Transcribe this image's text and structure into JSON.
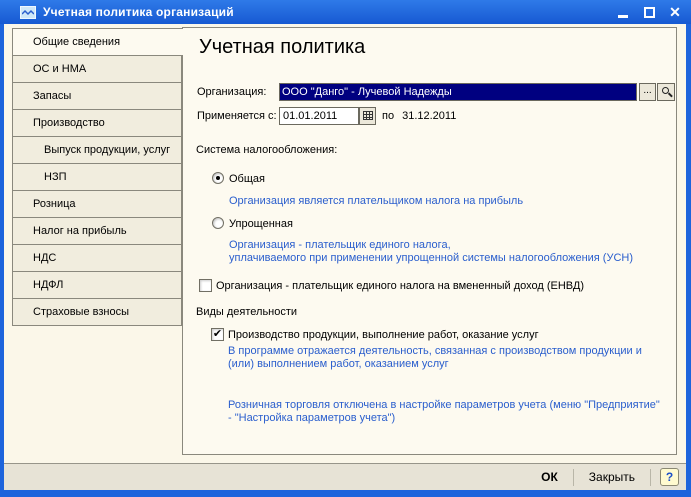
{
  "window": {
    "title": "Учетная политика организаций",
    "controls": {
      "minimize": "minimize",
      "maximize": "maximize",
      "close": "close"
    }
  },
  "sidebar": {
    "tabs": [
      {
        "label": "Общие сведения",
        "selected": true,
        "indent": false
      },
      {
        "label": "ОС и НМА",
        "selected": false,
        "indent": false
      },
      {
        "label": "Запасы",
        "selected": false,
        "indent": false
      },
      {
        "label": "Производство",
        "selected": false,
        "indent": false
      },
      {
        "label": "Выпуск продукции, услуг",
        "selected": false,
        "indent": true
      },
      {
        "label": "НЗП",
        "selected": false,
        "indent": true
      },
      {
        "label": "Розница",
        "selected": false,
        "indent": false
      },
      {
        "label": "Налог на прибыль",
        "selected": false,
        "indent": false
      },
      {
        "label": "НДС",
        "selected": false,
        "indent": false
      },
      {
        "label": "НДФЛ",
        "selected": false,
        "indent": false
      },
      {
        "label": "Страховые взносы",
        "selected": false,
        "indent": false
      }
    ]
  },
  "main": {
    "heading": "Учетная политика",
    "organization": {
      "label": "Организация:",
      "value": "ООО \"Данго\" - Лучевой Надежды",
      "ellipsis_button": "...",
      "magnifier_button": "magnifier"
    },
    "period": {
      "label": "Применяется с:",
      "from": "01.01.2011",
      "to_label": "по",
      "to": "31.12.2011"
    },
    "tax_system": {
      "label": "Система налогообложения:",
      "options": [
        {
          "label": "Общая",
          "selected": true,
          "note": "Организация является плательщиком налога на прибыль"
        },
        {
          "label": "Упрощенная",
          "selected": false,
          "note": "Организация - плательщик единого налога,\nуплачиваемого при применении упрощенной системы налогообложения (УСН)"
        }
      ]
    },
    "envd": {
      "label": "Организация - плательщик единого налога на вмененный доход (ЕНВД)",
      "checked": false
    },
    "activities": {
      "label": "Виды деятельности",
      "items": [
        {
          "label": "Производство  продукции, выполнение работ, оказание услуг",
          "checked": true,
          "checkmark": "✔",
          "note": "В программе отражается деятельность, связанная с производством продукции и\n(или) выполнением работ, оказанием услуг"
        }
      ]
    },
    "retail_note": "Розничная торговля отключена в настройке параметров учета (меню \"Предприятие\"\n- \"Настройка параметров учета\")"
  },
  "footer": {
    "ok": "ОК",
    "close": "Закрыть",
    "help": "?"
  },
  "colors": {
    "titlebar_blue": "#1d64dc",
    "client_background": "#fbf7e9",
    "panel_background": "#fdfaf0",
    "tab_background": "#f1edde",
    "selected_value_background": "#000080",
    "hint_text_blue": "#2a5ecd",
    "footer_background": "#e7e3d6"
  }
}
